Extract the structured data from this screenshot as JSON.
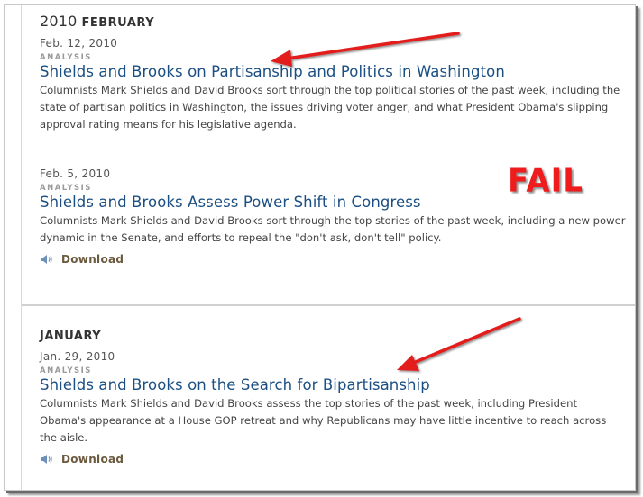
{
  "archive": {
    "february": {
      "year": "2010",
      "month": "FEBRUARY",
      "entries": [
        {
          "date": "Feb. 12, 2010",
          "kind": "ANALYSIS",
          "title": "Shields and Brooks on Partisanship and Politics in Washington",
          "description": "Columnists Mark Shields and David Brooks sort through the top political stories of the past week, including the state of partisan politics in Washington, the issues driving voter anger, and what President Obama's slipping approval rating means for his legislative agenda."
        },
        {
          "date": "Feb. 5, 2010",
          "kind": "ANALYSIS",
          "title": "Shields and Brooks Assess Power Shift in Congress",
          "description": "Columnists Mark Shields and David Brooks sort through the top stories of the past week, including a new power dynamic in the Senate, and efforts to repeal the \"don't ask, don't tell\" policy.",
          "download_label": "Download"
        }
      ]
    },
    "january": {
      "month": "JANUARY",
      "entries": [
        {
          "date": "Jan. 29, 2010",
          "kind": "ANALYSIS",
          "title": "Shields and Brooks on the Search for Bipartisanship",
          "description": "Columnists Mark Shields and David Brooks assess the top stories of the past week, including President Obama's appearance at a House GOP retreat and why Republicans may have little incentive to reach across the aisle.",
          "download_label": "Download"
        }
      ]
    }
  },
  "annotation": {
    "label": "FAIL",
    "color": "#ee1c1c"
  },
  "colors": {
    "link": "#1b4f83",
    "download": "#6b5a3e"
  },
  "icons": [
    "speaker-icon",
    "arrow-annotation-icon"
  ]
}
